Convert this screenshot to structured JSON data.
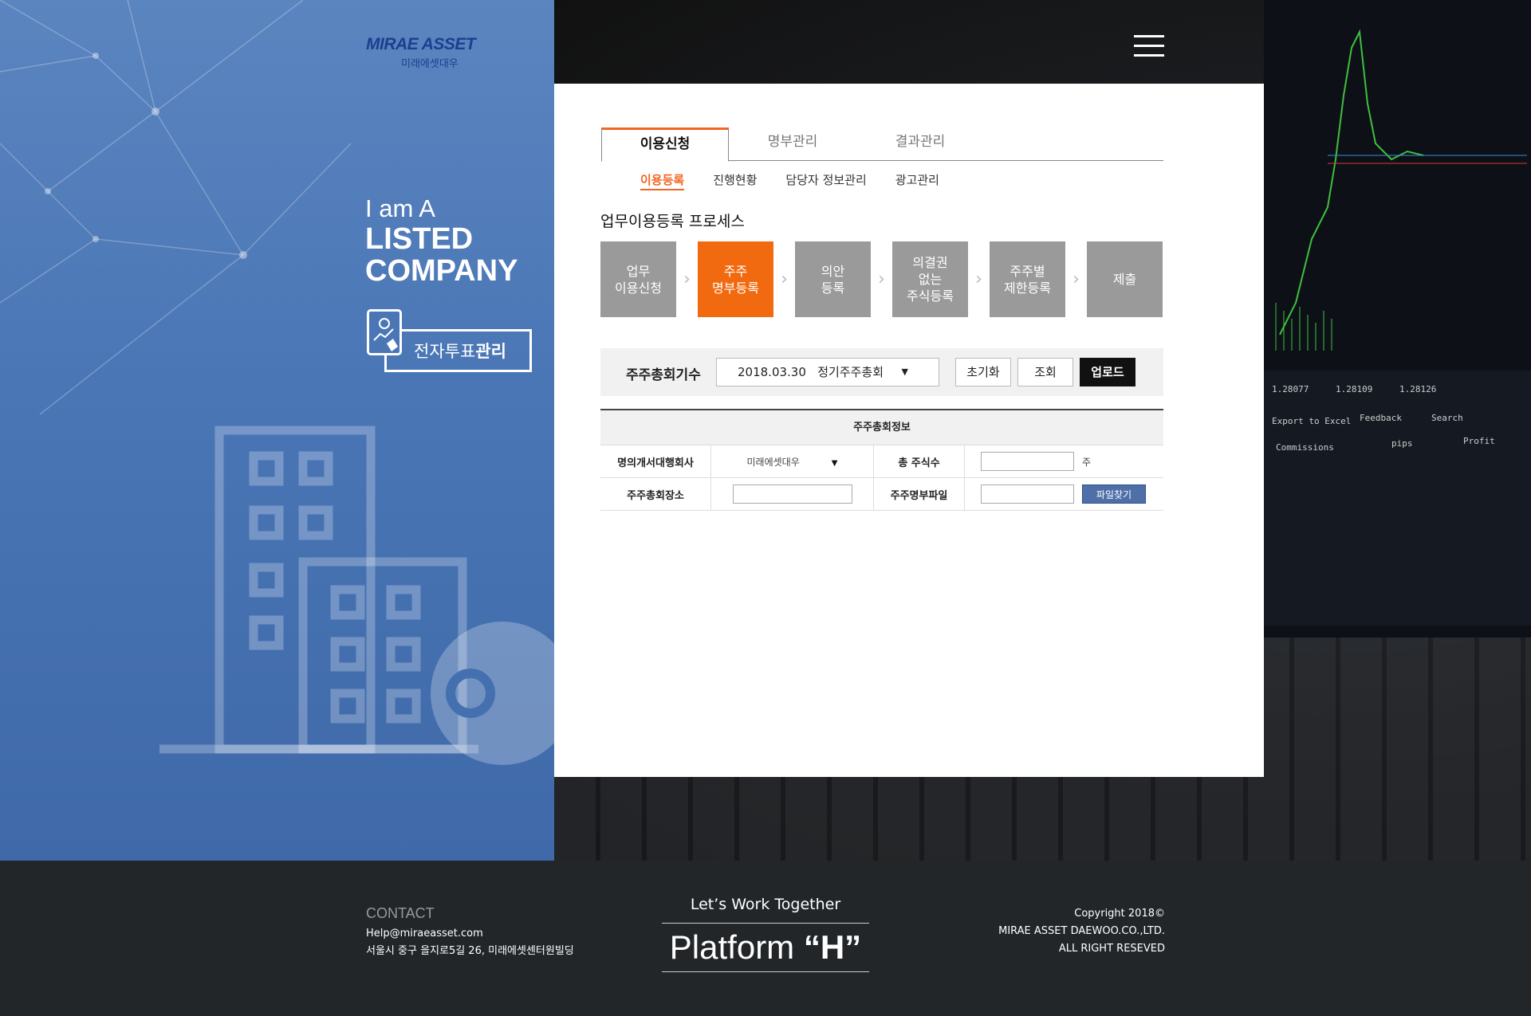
{
  "brand": {
    "name_en": "MIRAE ASSET",
    "name_ko": "미래에셋대우"
  },
  "tagline": {
    "line1": "I am A",
    "line2": "LISTED",
    "line3": "COMPANY"
  },
  "evote": {
    "label_normal": "전자투표",
    "label_bold": "관리"
  },
  "tabs": [
    {
      "label": "이용신청",
      "active": true
    },
    {
      "label": "명부관리",
      "active": false
    },
    {
      "label": "결과관리",
      "active": false
    }
  ],
  "subtabs": [
    {
      "label": "이용등록",
      "active": true
    },
    {
      "label": "진행현황",
      "active": false
    },
    {
      "label": "담당자 정보관리",
      "active": false
    },
    {
      "label": "광고관리",
      "active": false
    }
  ],
  "process": {
    "title": "업무이용등록 프로세스",
    "steps": [
      {
        "label": "업무\n이용신청",
        "active": false
      },
      {
        "label": "주주\n명부등록",
        "active": true
      },
      {
        "label": "의안\n등록",
        "active": false
      },
      {
        "label": "의결권\n없는\n주식등록",
        "active": false
      },
      {
        "label": "주주별\n제한등록",
        "active": false
      },
      {
        "label": "제출",
        "active": false
      }
    ]
  },
  "filter": {
    "label": "주주총회기수",
    "selected": "2018.03.30   정기주주총회",
    "reset": "초기화",
    "search": "조회",
    "upload": "업로드"
  },
  "info": {
    "title": "주주총회정보",
    "agent_label": "명의개서대행회사",
    "agent_value": "미래에셋대우",
    "total_shares_label": "총 주식수",
    "total_shares_value": "",
    "share_unit": "주",
    "place_label": "주주총회장소",
    "place_value": "",
    "file_label": "주주명부파일",
    "file_value": "",
    "file_button": "파일찾기"
  },
  "footer": {
    "contact_title": "CONTACT",
    "email": "Help@miraeasset.com",
    "address": "서울시 중구 을지로5길 26, 미래에셋센터원빌딩",
    "lets": "Let’s Work Together",
    "platform": "Platform",
    "platform_h": "“H”",
    "copyright": "Copyright 2018©",
    "company": "MIRAE ASSET DAEWOO.CO.,LTD.",
    "rights": "ALL RIGHT RESEVED"
  },
  "colors": {
    "accent": "#f26a0f",
    "blue_panel": "#4a76b6",
    "footer": "#232629"
  }
}
